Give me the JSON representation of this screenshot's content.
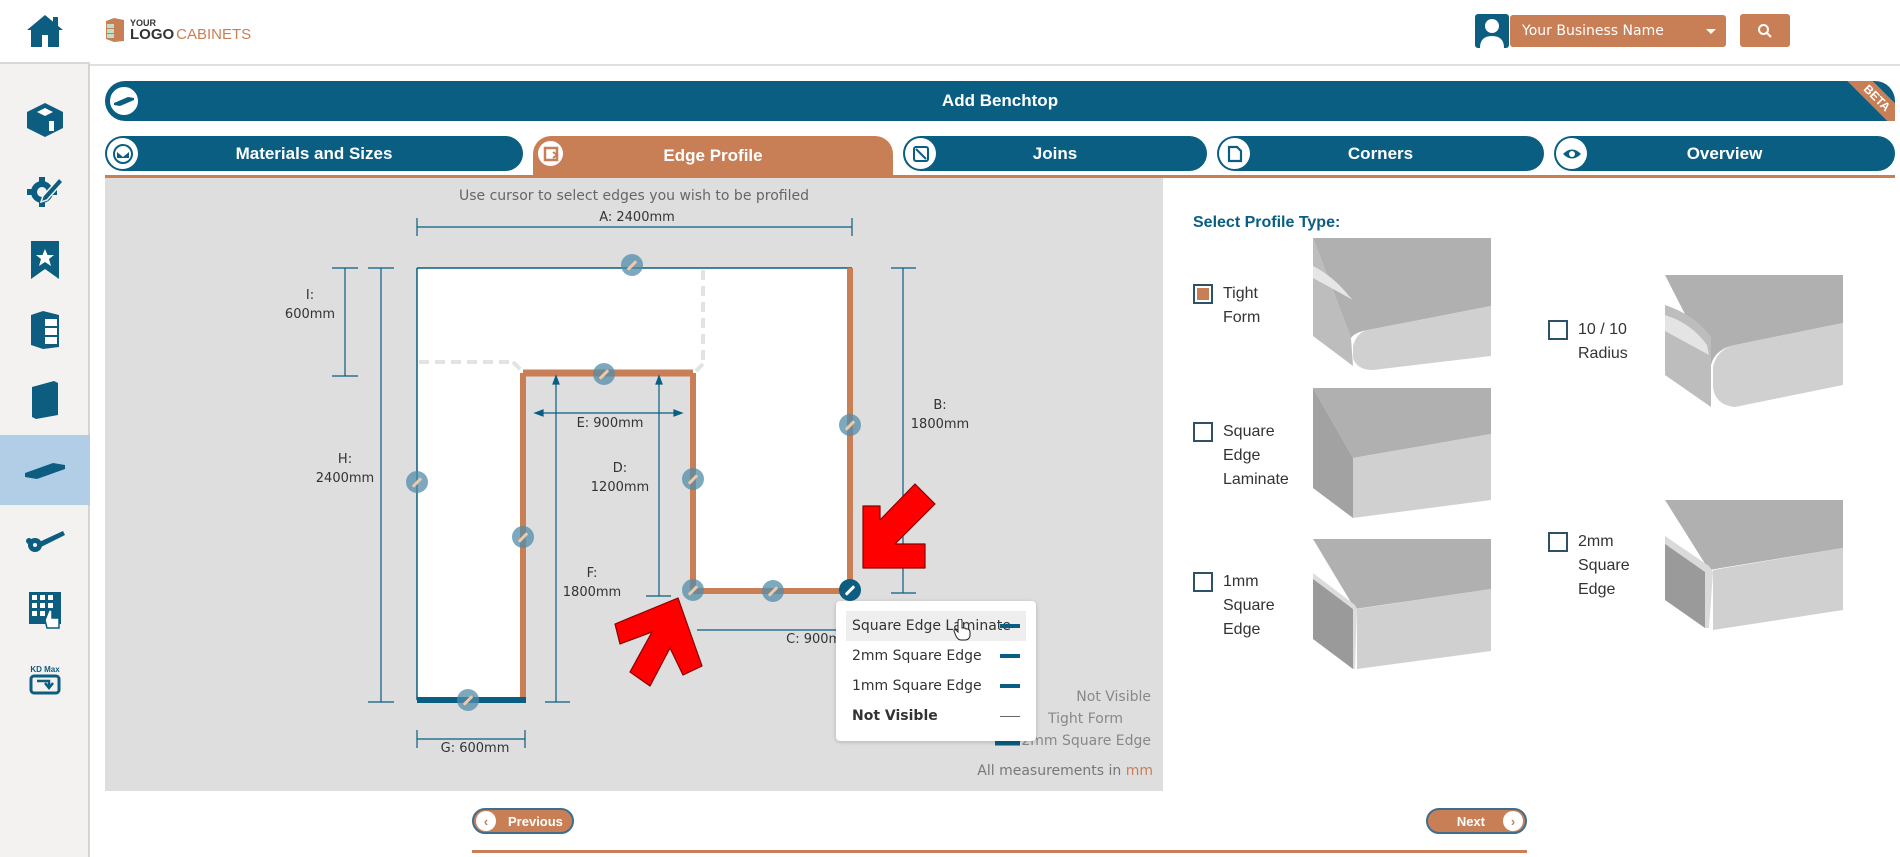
{
  "app": {
    "brand": {
      "your": "YOUR",
      "logo": "LOGO",
      "cabinets": "CABINETS"
    },
    "business_select": "Your Business Name"
  },
  "sidebar": {
    "items": [
      {
        "name": "home",
        "icon": "house-icon"
      },
      {
        "name": "room",
        "icon": "room-icon"
      },
      {
        "name": "settings",
        "icon": "gear-pencil-icon"
      },
      {
        "name": "favourites",
        "icon": "bookmark-star-icon"
      },
      {
        "name": "cabinets",
        "icon": "cabinet-icon"
      },
      {
        "name": "panels",
        "icon": "panel-icon"
      },
      {
        "name": "benchtop",
        "icon": "benchtop-icon",
        "active": true
      },
      {
        "name": "hardware",
        "icon": "hinge-icon"
      },
      {
        "name": "grid-select",
        "icon": "grid-hand-icon"
      },
      {
        "name": "kd-max",
        "icon": "kd-max-icon",
        "label": "KD Max"
      }
    ]
  },
  "header": {
    "title": "Add Benchtop",
    "badge": "BETA"
  },
  "tabs": [
    {
      "label": "Materials and Sizes",
      "icon": "materials-icon",
      "active": false
    },
    {
      "label": "Edge Profile",
      "icon": "edge-profile-icon",
      "active": true
    },
    {
      "label": "Joins",
      "icon": "joins-icon",
      "active": false
    },
    {
      "label": "Corners",
      "icon": "corners-icon",
      "active": false
    },
    {
      "label": "Overview",
      "icon": "eye-icon",
      "active": false
    }
  ],
  "diagram": {
    "instruction": "Use cursor to select edges you wish to be profiled",
    "dimensions": {
      "A": {
        "label": "A: 2400mm"
      },
      "B": {
        "label": "B:",
        "value": "1800mm"
      },
      "C": {
        "label": "C: 900mm"
      },
      "D": {
        "label": "D:",
        "value": "1200mm"
      },
      "E": {
        "label": "E: 900mm"
      },
      "F": {
        "label": "F:",
        "value": "1800mm"
      },
      "G": {
        "label": "G: 600mm"
      },
      "H": {
        "label": "H:",
        "value": "2400mm"
      },
      "I": {
        "label": "I:",
        "value": "600mm"
      }
    },
    "legend": [
      {
        "label": "Not Visible"
      },
      {
        "label": "Tight Form"
      },
      {
        "label": "2mm Square Edge"
      }
    ],
    "measurement_note": "All measurements in",
    "measurement_unit": "mm",
    "colors": {
      "tight_form": "#c97f56",
      "square_edge": "#095e82",
      "annotation_arrow": "#ff0000"
    }
  },
  "edge_popup": {
    "items": [
      {
        "label": "Square Edge Laminate",
        "hover": true
      },
      {
        "label": "2mm Square Edge"
      },
      {
        "label": "1mm Square Edge"
      },
      {
        "label": "Not Visible",
        "bold": true
      }
    ]
  },
  "profile": {
    "title": "Select Profile Type:",
    "options": [
      {
        "label": "Tight Form",
        "checked": true
      },
      {
        "label": "10 / 10 Radius",
        "checked": false
      },
      {
        "label": "Square Edge Laminate",
        "checked": false
      },
      {
        "label": "2mm Square Edge",
        "checked": false
      },
      {
        "label": "1mm Square Edge",
        "checked": false
      }
    ]
  },
  "nav": {
    "previous": "Previous",
    "next": "Next"
  }
}
